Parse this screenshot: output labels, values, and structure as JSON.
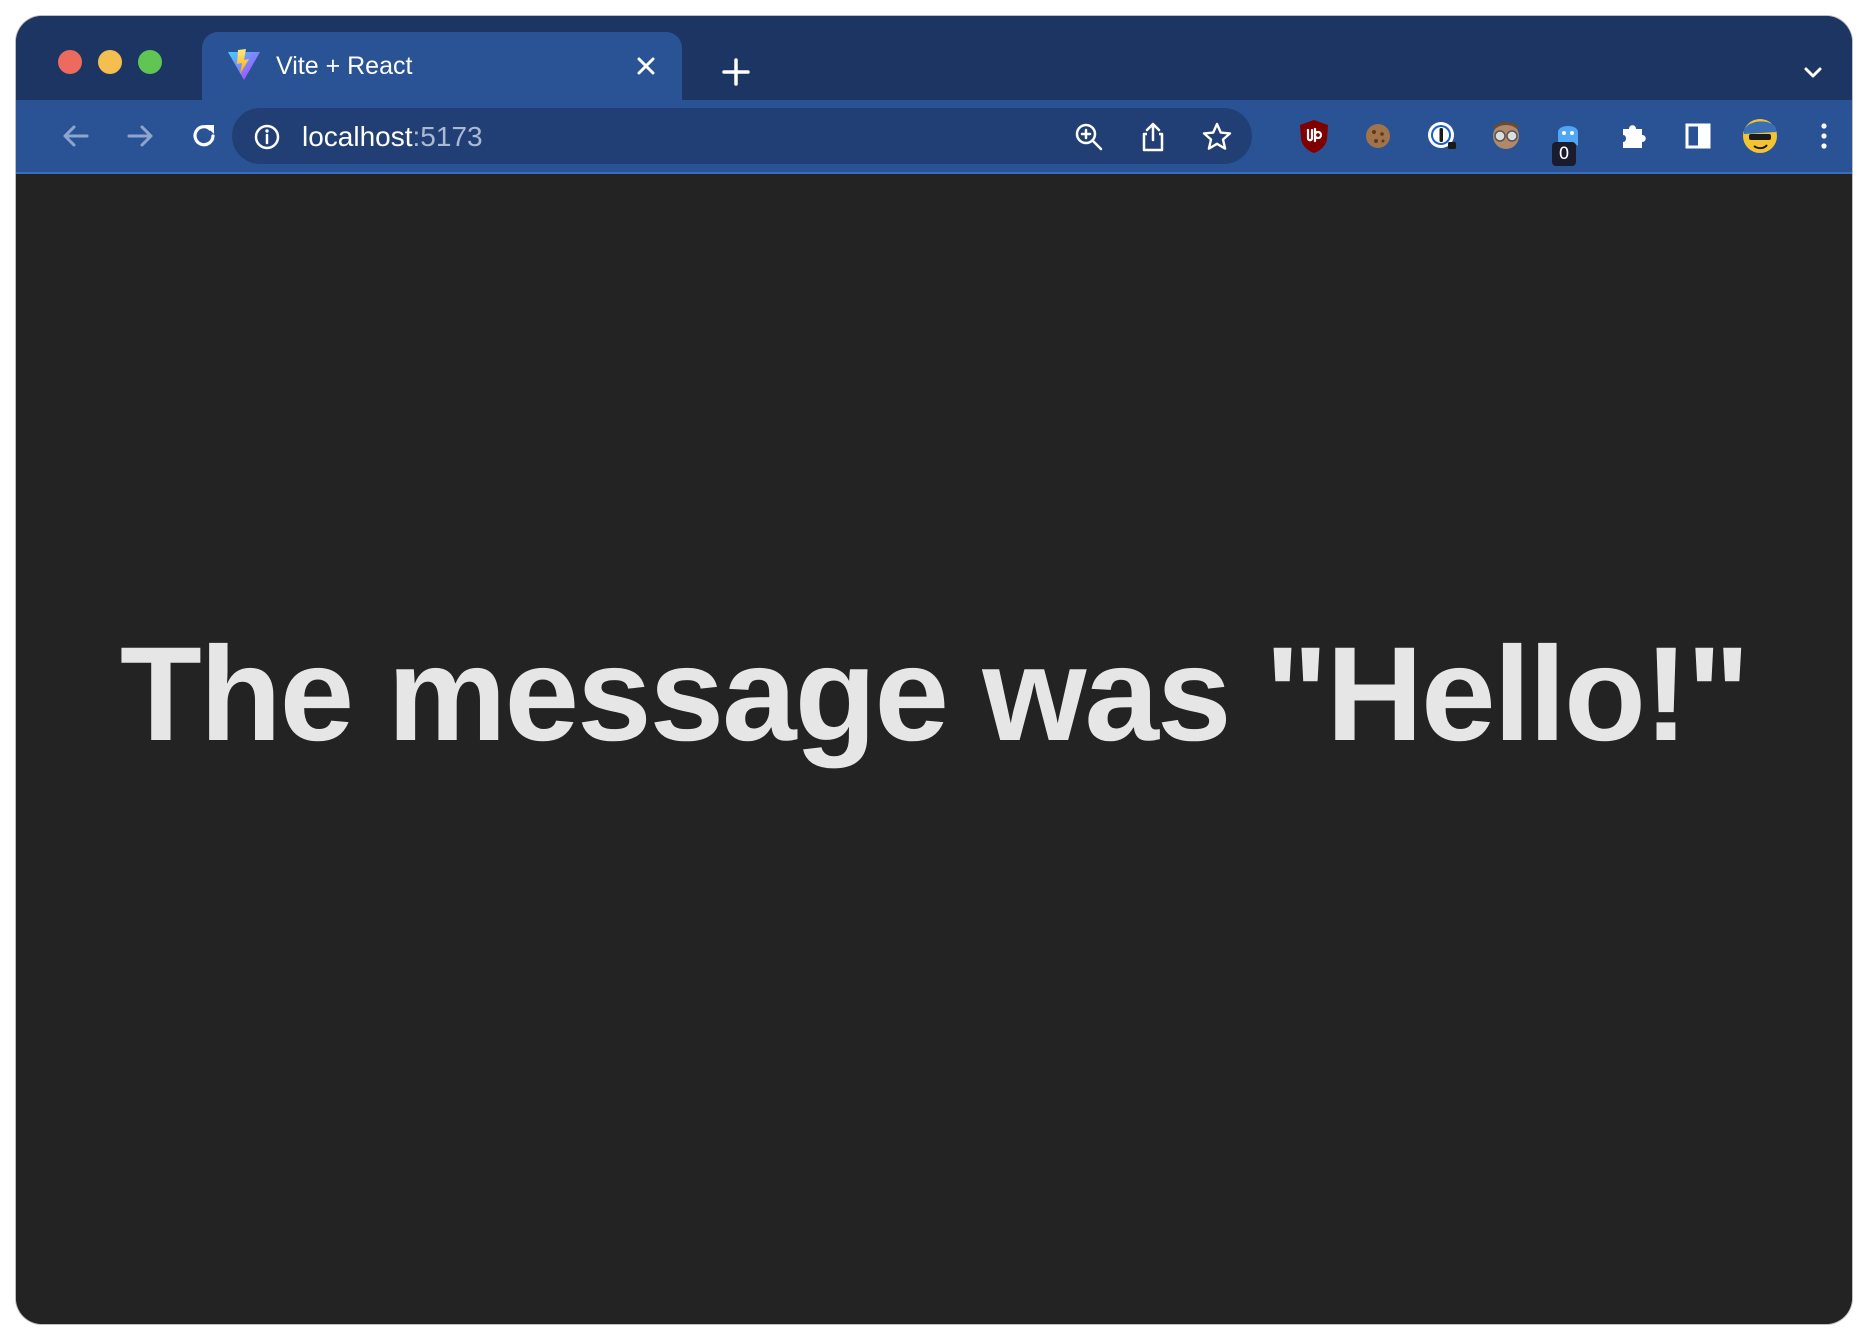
{
  "browser": {
    "tab": {
      "title": "Vite + React",
      "favicon": "vite-logo-icon"
    },
    "address_bar": {
      "host": "localhost",
      "port": ":5173"
    },
    "extensions": [
      {
        "name": "ublock-origin-icon"
      },
      {
        "name": "cookie-icon"
      },
      {
        "name": "1password-icon"
      },
      {
        "name": "glasses-face-icon"
      },
      {
        "name": "ghostery-icon",
        "badge": "0"
      },
      {
        "name": "extensions-puzzle-icon"
      },
      {
        "name": "side-panel-icon"
      },
      {
        "name": "profile-avatar-icon"
      },
      {
        "name": "kebab-menu-icon"
      }
    ],
    "colors": {
      "tabstrip": "#1c3563",
      "active_tab": "#2a5396",
      "omnibox": "#223f75",
      "page_background": "#232323",
      "page_text": "#e6e6e6"
    }
  },
  "page": {
    "message": "The message was \"Hello!\""
  }
}
